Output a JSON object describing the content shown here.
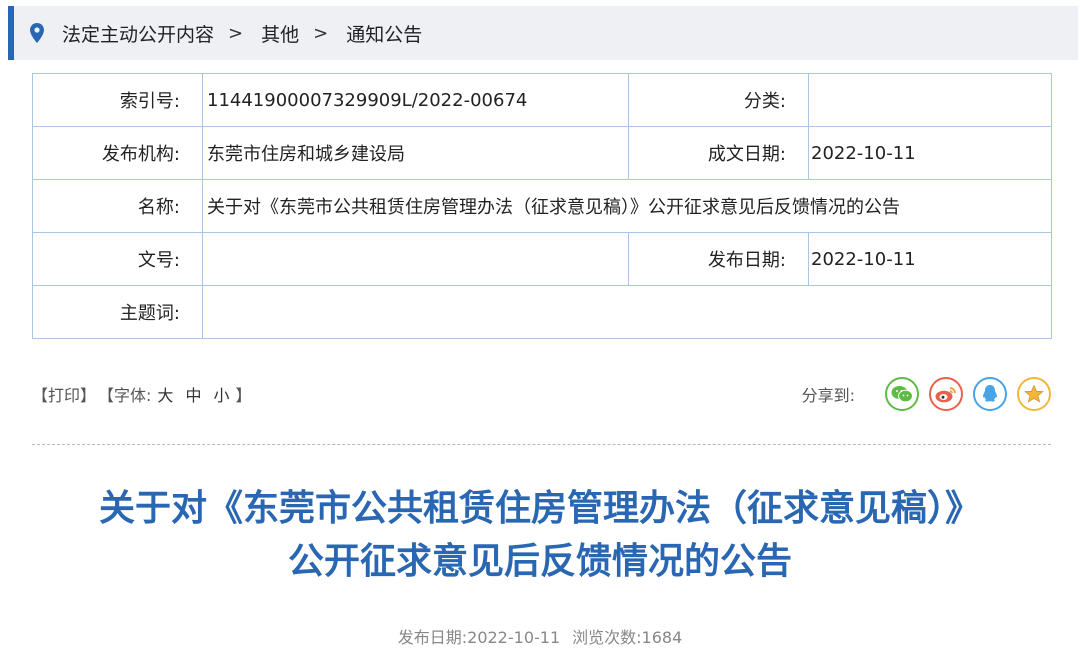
{
  "breadcrumb": {
    "items": [
      "法定主动公开内容",
      "其他",
      "通知公告"
    ],
    "separator": ">"
  },
  "info": {
    "index_label": "索引号:",
    "index_value": "11441900007329909L/2022-00674",
    "category_label": "分类:",
    "category_value": "",
    "publisher_label": "发布机构:",
    "publisher_value": "东莞市住房和城乡建设局",
    "written_date_label": "成文日期:",
    "written_date_value": "2022-10-11",
    "name_label": "名称:",
    "name_value": "关于对《东莞市公共租赁住房管理办法（征求意见稿）》公开征求意见后反馈情况的公告",
    "doc_no_label": "文号:",
    "doc_no_value": "",
    "publish_date_label": "发布日期:",
    "publish_date_value": "2022-10-11",
    "keywords_label": "主题词:",
    "keywords_value": ""
  },
  "toolbar": {
    "print": "【打印】",
    "font_prefix": "【字体:",
    "font_large": "大",
    "font_medium": "中",
    "font_small": "小",
    "font_suffix": "】",
    "share_label": "分享到:",
    "share_icons": [
      "wechat-icon",
      "weibo-icon",
      "qq-icon",
      "favorite-icon"
    ]
  },
  "article": {
    "title_line1": "关于对《东莞市公共租赁住房管理办法（征求意见稿）》",
    "title_line2": "公开征求意见后反馈情况的公告",
    "meta_date_label": "发布日期:",
    "meta_date": "2022-10-11",
    "meta_views_label": "浏览次数:",
    "meta_views": "1684"
  },
  "colors": {
    "accent": "#2a67b3",
    "table_border": "#a9c6e4",
    "breadcrumb_bg": "#eef0f4"
  }
}
